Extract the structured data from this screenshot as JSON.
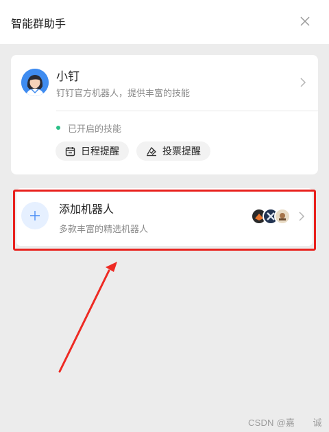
{
  "header": {
    "title": "智能群助手",
    "close_icon": "close-icon"
  },
  "robot_card": {
    "name": "小钉",
    "description": "钉钉官方机器人，提供丰富的技能",
    "status_text": "已开启的技能",
    "status_color": "#2bbf87",
    "skills": [
      {
        "label": "日程提醒",
        "icon": "calendar-icon"
      },
      {
        "label": "投票提醒",
        "icon": "vote-icon"
      }
    ]
  },
  "add_card": {
    "title": "添加机器人",
    "description": "多款丰富的精选机器人",
    "icon": "plus-icon"
  },
  "annotation": {
    "highlight_color": "#e8211d"
  },
  "watermark": "CSDN @嘉　　诚"
}
